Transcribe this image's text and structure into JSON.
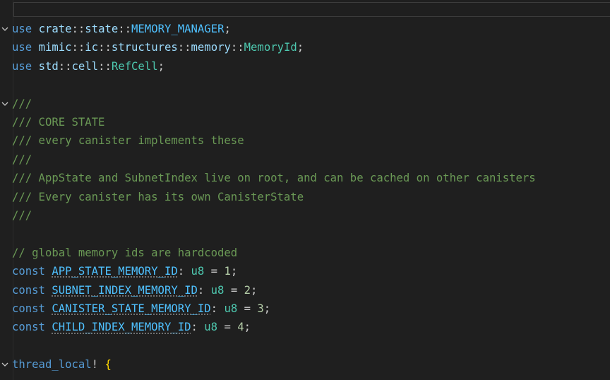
{
  "editor": {
    "lines": [
      {
        "fold": true,
        "tokens": [
          {
            "t": "use",
            "c": "kw"
          },
          {
            "t": " ",
            "c": "pun"
          },
          {
            "t": "crate",
            "c": "id"
          },
          {
            "t": "::",
            "c": "pun"
          },
          {
            "t": "state",
            "c": "id"
          },
          {
            "t": "::",
            "c": "pun"
          },
          {
            "t": "MEMORY_MANAGER",
            "c": "cst"
          },
          {
            "t": ";",
            "c": "pun"
          }
        ]
      },
      {
        "fold": false,
        "tokens": [
          {
            "t": "use",
            "c": "kw"
          },
          {
            "t": " ",
            "c": "pun"
          },
          {
            "t": "mimic",
            "c": "id"
          },
          {
            "t": "::",
            "c": "pun"
          },
          {
            "t": "ic",
            "c": "id"
          },
          {
            "t": "::",
            "c": "pun"
          },
          {
            "t": "structures",
            "c": "id"
          },
          {
            "t": "::",
            "c": "pun"
          },
          {
            "t": "memory",
            "c": "id"
          },
          {
            "t": "::",
            "c": "pun"
          },
          {
            "t": "MemoryId",
            "c": "ty"
          },
          {
            "t": ";",
            "c": "pun"
          }
        ]
      },
      {
        "fold": false,
        "tokens": [
          {
            "t": "use",
            "c": "kw"
          },
          {
            "t": " ",
            "c": "pun"
          },
          {
            "t": "std",
            "c": "id"
          },
          {
            "t": "::",
            "c": "pun"
          },
          {
            "t": "cell",
            "c": "id"
          },
          {
            "t": "::",
            "c": "pun"
          },
          {
            "t": "RefCell",
            "c": "ty"
          },
          {
            "t": ";",
            "c": "pun"
          }
        ]
      },
      {
        "fold": false,
        "tokens": []
      },
      {
        "fold": true,
        "tokens": [
          {
            "t": "///",
            "c": "com"
          }
        ]
      },
      {
        "fold": false,
        "tokens": [
          {
            "t": "/// CORE STATE",
            "c": "com"
          }
        ]
      },
      {
        "fold": false,
        "tokens": [
          {
            "t": "/// every canister implements these",
            "c": "com"
          }
        ]
      },
      {
        "fold": false,
        "tokens": [
          {
            "t": "///",
            "c": "com"
          }
        ]
      },
      {
        "fold": false,
        "tokens": [
          {
            "t": "/// AppState and SubnetIndex live on root, and can be cached on other canisters",
            "c": "com"
          }
        ]
      },
      {
        "fold": false,
        "tokens": [
          {
            "t": "/// Every canister has its own CanisterState",
            "c": "com"
          }
        ]
      },
      {
        "fold": false,
        "tokens": [
          {
            "t": "///",
            "c": "com"
          }
        ]
      },
      {
        "fold": false,
        "tokens": []
      },
      {
        "fold": false,
        "tokens": [
          {
            "t": "// global memory ids are hardcoded",
            "c": "com"
          }
        ]
      },
      {
        "fold": false,
        "tokens": [
          {
            "t": "const",
            "c": "kw"
          },
          {
            "t": " ",
            "c": "pun"
          },
          {
            "t": "APP_STATE_MEMORY_ID",
            "c": "cst ul"
          },
          {
            "t": ": ",
            "c": "pun"
          },
          {
            "t": "u8",
            "c": "ty"
          },
          {
            "t": " = ",
            "c": "pun"
          },
          {
            "t": "1",
            "c": "num"
          },
          {
            "t": ";",
            "c": "pun"
          }
        ]
      },
      {
        "fold": false,
        "tokens": [
          {
            "t": "const",
            "c": "kw"
          },
          {
            "t": " ",
            "c": "pun"
          },
          {
            "t": "SUBNET_INDEX_MEMORY_ID",
            "c": "cst ul"
          },
          {
            "t": ": ",
            "c": "pun"
          },
          {
            "t": "u8",
            "c": "ty"
          },
          {
            "t": " = ",
            "c": "pun"
          },
          {
            "t": "2",
            "c": "num"
          },
          {
            "t": ";",
            "c": "pun"
          }
        ]
      },
      {
        "fold": false,
        "tokens": [
          {
            "t": "const",
            "c": "kw"
          },
          {
            "t": " ",
            "c": "pun"
          },
          {
            "t": "CANISTER_STATE_MEMORY_ID",
            "c": "cst ul"
          },
          {
            "t": ": ",
            "c": "pun"
          },
          {
            "t": "u8",
            "c": "ty"
          },
          {
            "t": " = ",
            "c": "pun"
          },
          {
            "t": "3",
            "c": "num"
          },
          {
            "t": ";",
            "c": "pun"
          }
        ]
      },
      {
        "fold": false,
        "tokens": [
          {
            "t": "const",
            "c": "kw"
          },
          {
            "t": " ",
            "c": "pun"
          },
          {
            "t": "CHILD_INDEX_MEMORY_ID",
            "c": "cst ul"
          },
          {
            "t": ": ",
            "c": "pun"
          },
          {
            "t": "u8",
            "c": "ty"
          },
          {
            "t": " = ",
            "c": "pun"
          },
          {
            "t": "4",
            "c": "num"
          },
          {
            "t": ";",
            "c": "pun"
          }
        ]
      },
      {
        "fold": false,
        "tokens": []
      },
      {
        "fold": true,
        "tokens": [
          {
            "t": "thread_local",
            "c": "mac"
          },
          {
            "t": "! ",
            "c": "pun"
          },
          {
            "t": "{",
            "c": "brace"
          }
        ]
      }
    ]
  }
}
